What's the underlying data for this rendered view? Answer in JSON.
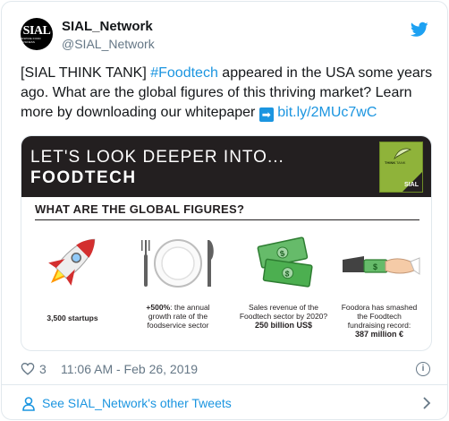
{
  "tweet": {
    "display_name": "SIAL_Network",
    "handle": "@SIAL_Network",
    "avatar_mark": "SIAL",
    "avatar_sub": "INSPIRE FOOD BUSINESS",
    "text_part1": "[SIAL THINK TANK] ",
    "hashtag": "#Foodtech",
    "text_part2": " appeared in the USA some years ago. What are the global figures of this thriving market? Learn more by downloading our whitepaper ",
    "arrow_glyph": "➡",
    "link": "bit.ly/2MUc7wC",
    "likes": "3",
    "timestamp": "11:06 AM - Feb 26, 2019",
    "info_glyph": "i",
    "footer_label": "See SIAL_Network's other Tweets"
  },
  "infographic": {
    "banner_line1": "LET'S LOOK DEEPER INTO...",
    "banner_line2": "FOODTECH",
    "think_tank_word1": "THINK",
    "think_tank_word2": "TANK",
    "think_tank_sial": "SIAL",
    "section_title": "WHAT ARE THE GLOBAL FIGURES?",
    "figures": [
      {
        "icon": "rocket-icon",
        "line1": "3,500 startups"
      },
      {
        "icon": "plate-icon",
        "bold": "+500%",
        "line1": ": the annual",
        "line2": "growth rate of the",
        "line3": "foodservice sector"
      },
      {
        "icon": "money-icon",
        "line1": "Sales revenue of the",
        "line2": "Foodtech sector by 2020?",
        "strong": "250 billion US$"
      },
      {
        "icon": "handshake-money-icon",
        "line1": "Foodora has smashed",
        "line2": "the Foodtech",
        "line3": "fundraising record:",
        "strong": "387 million €"
      }
    ]
  },
  "colors": {
    "link": "#1b95e0",
    "banner": "#231f20",
    "think_tank_green": "#8fb33a",
    "money_green": "#4caf50",
    "rocket_red": "#d32f2f"
  }
}
